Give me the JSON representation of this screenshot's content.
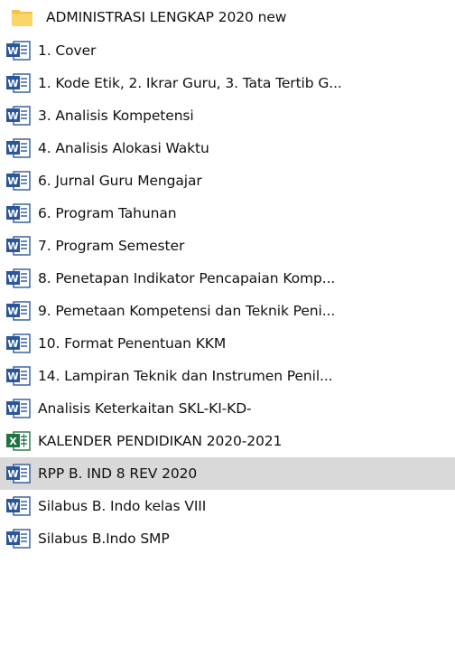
{
  "file_list": {
    "items": [
      {
        "label": "ADMINISTRASI LENGKAP 2020 new",
        "icon": "folder-icon",
        "type": "folder",
        "selected": false
      },
      {
        "label": "1. Cover",
        "icon": "word-doc-icon",
        "type": "word",
        "selected": false
      },
      {
        "label": "1. Kode Etik, 2. Ikrar Guru, 3. Tata Tertib G...",
        "icon": "word-doc-icon",
        "type": "word",
        "selected": false
      },
      {
        "label": "3. Analisis Kompetensi",
        "icon": "word-doc-icon",
        "type": "word",
        "selected": false
      },
      {
        "label": "4. Analisis Alokasi Waktu",
        "icon": "word-doc-icon",
        "type": "word",
        "selected": false
      },
      {
        "label": "6. Jurnal Guru Mengajar",
        "icon": "word-doc-icon",
        "type": "word",
        "selected": false
      },
      {
        "label": "6. Program Tahunan",
        "icon": "word-doc-icon",
        "type": "word",
        "selected": false
      },
      {
        "label": "7. Program Semester",
        "icon": "word-doc-icon",
        "type": "word",
        "selected": false
      },
      {
        "label": "8. Penetapan Indikator Pencapaian Komp...",
        "icon": "word-doc-icon",
        "type": "word",
        "selected": false
      },
      {
        "label": "9. Pemetaan Kompetensi dan Teknik Peni...",
        "icon": "word-doc-icon",
        "type": "word",
        "selected": false
      },
      {
        "label": "10. Format Penentuan KKM",
        "icon": "word-doc-icon",
        "type": "word",
        "selected": false
      },
      {
        "label": "14. Lampiran Teknik dan Instrumen Penil...",
        "icon": "word-doc-icon",
        "type": "word",
        "selected": false
      },
      {
        "label": "Analisis Keterkaitan SKL-KI-KD-",
        "icon": "word-doc-icon",
        "type": "word",
        "selected": false
      },
      {
        "label": "KALENDER PENDIDIKAN 2020-2021",
        "icon": "excel-sheet-icon",
        "type": "excel",
        "selected": false
      },
      {
        "label": "RPP B. IND 8 REV 2020",
        "icon": "word-doc-icon",
        "type": "word",
        "selected": true
      },
      {
        "label": "Silabus B. Indo kelas VIII",
        "icon": "word-doc-icon",
        "type": "word",
        "selected": false
      },
      {
        "label": "Silabus B.Indo SMP",
        "icon": "word-doc-icon",
        "type": "word",
        "selected": false
      }
    ]
  },
  "colors": {
    "selected_background": "#d9d9d9",
    "folder_yellow": "#f8c846",
    "word_blue": "#2b579a",
    "excel_green": "#217346"
  }
}
